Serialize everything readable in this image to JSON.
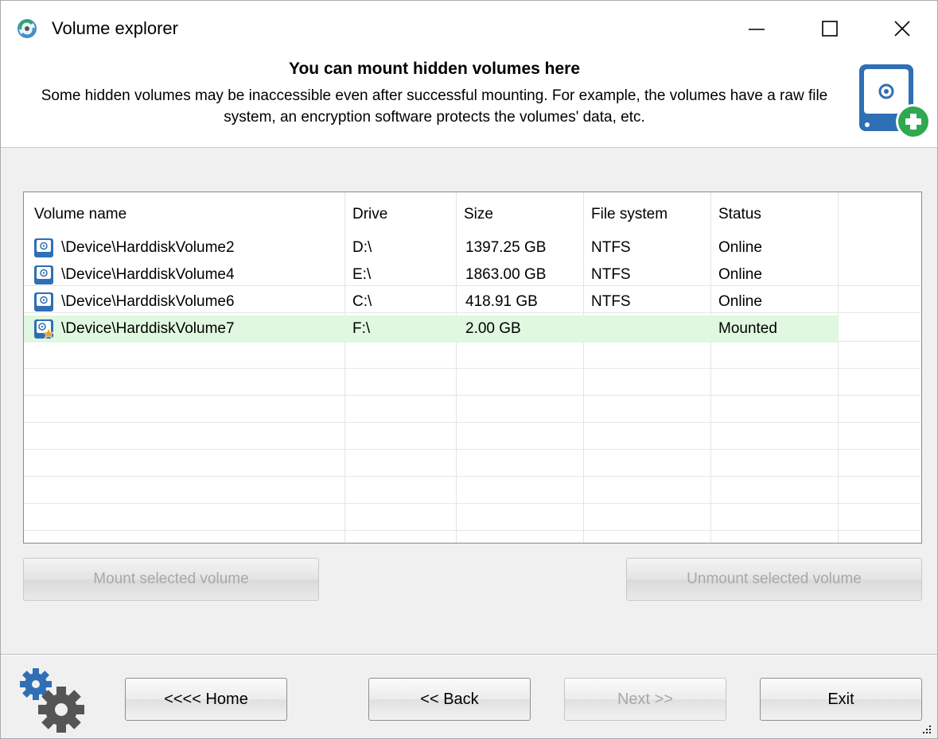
{
  "window": {
    "title": "Volume explorer",
    "controls": {
      "minimize": "—",
      "maximize": "☐",
      "close": "✕"
    }
  },
  "header": {
    "title": "You can mount hidden volumes here",
    "description": "Some hidden volumes may be inaccessible even after successful mounting. For example, the volumes have a raw file system, an encryption software protects the volumes' data, etc.",
    "icon": "disk-add-icon"
  },
  "table": {
    "columns": [
      "Volume name",
      "Drive",
      "Size",
      "File system",
      "Status"
    ],
    "rows": [
      {
        "name": "\\Device\\HarddiskVolume2",
        "drive": "D:\\",
        "size": "1397.25 GB",
        "fs": "NTFS",
        "status": "Online",
        "icon": "volume-icon"
      },
      {
        "name": "\\Device\\HarddiskVolume4",
        "drive": "E:\\",
        "size": "1863.00 GB",
        "fs": "NTFS",
        "status": "Online",
        "icon": "volume-icon"
      },
      {
        "name": "\\Device\\HarddiskVolume6",
        "drive": "C:\\",
        "size": "418.91 GB",
        "fs": "NTFS",
        "status": "Online",
        "icon": "volume-icon"
      },
      {
        "name": "\\Device\\HarddiskVolume7",
        "drive": "F:\\",
        "size": "2.00 GB",
        "fs": "",
        "status": "Mounted",
        "icon": "mounted-volume-icon"
      }
    ]
  },
  "actions": {
    "mount": "Mount selected volume",
    "unmount": "Unmount selected volume"
  },
  "nav": {
    "home": "<<<< Home",
    "back": "<< Back",
    "next": "Next >>",
    "exit": "Exit"
  },
  "colors": {
    "mounted_row": "#dff8df",
    "icon_blue": "#2f6fb5",
    "plus_green": "#2fa84f"
  }
}
